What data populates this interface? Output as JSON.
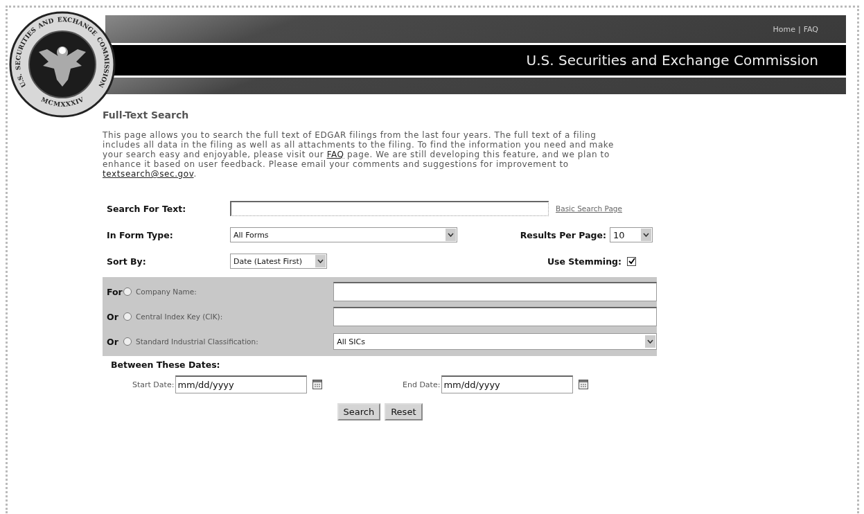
{
  "seal": {
    "ring_words": [
      "U.S.",
      "SECURITIES",
      "AND",
      "EXCHANGE",
      "COMMISSION"
    ],
    "year": "MCMXXXIV"
  },
  "header": {
    "nav": [
      {
        "label": "Home"
      },
      {
        "label": "FAQ"
      }
    ],
    "separator": "|",
    "title": "U.S. Securities and Exchange Commission"
  },
  "page_title": "Full-Text Search",
  "intro": {
    "parts": [
      {
        "kind": "text",
        "text": "This page allows you to search the full text of EDGAR filings from the last four years. The full text of a filing includes all data in the filing as well as all attachments to the filing. To find the information you need and make your search easy and enjoyable, please visit our "
      },
      {
        "kind": "link",
        "text": "FAQ"
      },
      {
        "kind": "text",
        "text": " page. We are still developing this feature, and we plan to enhance it based on user feedback. Please email your comments and suggestions for improvement to "
      },
      {
        "kind": "link",
        "text": "textsearch@sec.gov"
      },
      {
        "kind": "text",
        "text": "."
      }
    ]
  },
  "search_for_text": {
    "label": "Search For Text:",
    "link": "Basic Search Page"
  },
  "form_type": {
    "label": "In Form Type:",
    "value": "All Forms"
  },
  "results_per_page": {
    "label": "Results Per Page:",
    "value": "10"
  },
  "sort_by": {
    "label": "Sort By:",
    "value": "Date (Latest First)"
  },
  "use_stemming": {
    "label": "Use Stemming:",
    "checked": true
  },
  "filters": [
    {
      "prefix": "For",
      "label": "Company Name:",
      "selected": false,
      "kind": "text"
    },
    {
      "prefix": "Or",
      "label": "Central Index Key (CIK):",
      "selected": false,
      "kind": "text"
    },
    {
      "prefix": "Or",
      "label": "Standard Industrial Classification:",
      "selected": false,
      "kind": "select",
      "value": "All SICs"
    }
  ],
  "dates": {
    "heading": "Between These Dates:",
    "start": {
      "label": "Start Date:",
      "value": "mm/dd/yyyy"
    },
    "end": {
      "label": "End Date:",
      "value": "mm/dd/yyyy"
    }
  },
  "buttons": [
    {
      "label": "Search"
    },
    {
      "label": "Reset"
    }
  ]
}
